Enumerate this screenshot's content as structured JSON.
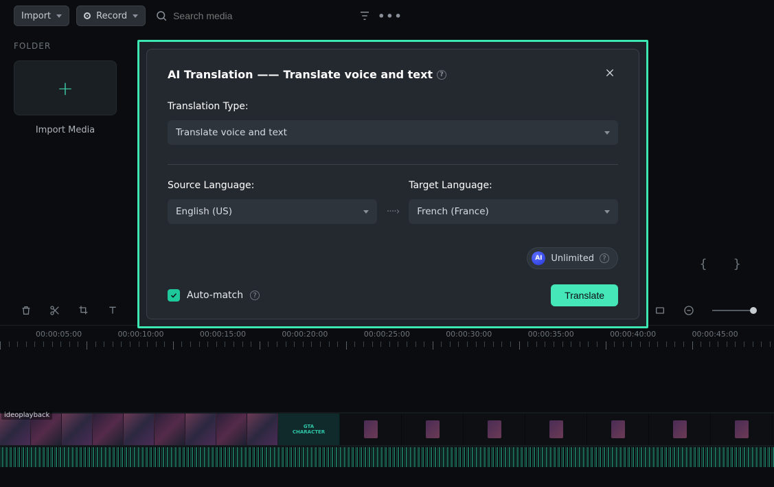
{
  "toolbar": {
    "import": "Import",
    "record": "Record",
    "search_placeholder": "Search media"
  },
  "folder": {
    "label": "FOLDER",
    "import_caption": "Import Media"
  },
  "braces": "{   }",
  "timeline": {
    "labels": [
      "00:00:05:00",
      "00:00:10:00",
      "00:00:15:00",
      "00:00:20:00",
      "00:00:25:00",
      "00:00:30:00",
      "00:00:35:00",
      "00:00:40:00",
      "00:00:45:00"
    ],
    "clip_label": "ideoplayback",
    "gta_line1": "GTA",
    "gta_line2": "CHARACTER"
  },
  "modal": {
    "title_prefix": "AI Translation",
    "title_dash": "——",
    "title_suffix": "Translate voice and text",
    "type_label": "Translation Type:",
    "type_value": "Translate voice and text",
    "source_label": "Source Language:",
    "source_value": "English (US)",
    "target_label": "Target Language:",
    "target_value": "French (France)",
    "ai_badge": "AI",
    "unlimited": "Unlimited",
    "auto_match": "Auto-match",
    "translate": "Translate"
  }
}
